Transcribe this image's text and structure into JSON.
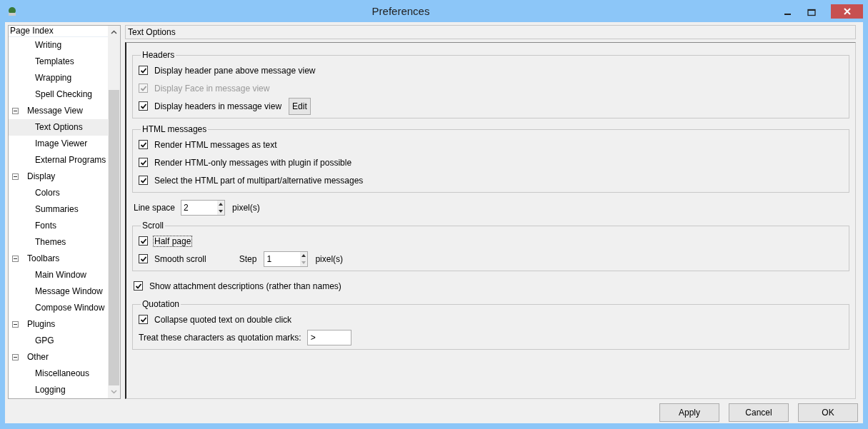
{
  "window": {
    "title": "Preferences"
  },
  "sidebar": {
    "header": "Page Index",
    "items": [
      {
        "children": [
          {
            "label": "Writing",
            "selected": false
          },
          {
            "label": "Templates",
            "selected": false
          },
          {
            "label": "Wrapping",
            "selected": false
          },
          {
            "label": "Spell Checking",
            "selected": false
          }
        ]
      },
      {
        "label": "Message View",
        "expanded": true,
        "children": [
          {
            "label": "Text Options",
            "selected": true
          },
          {
            "label": "Image Viewer",
            "selected": false
          },
          {
            "label": "External Programs",
            "selected": false
          }
        ]
      },
      {
        "label": "Display",
        "expanded": true,
        "children": [
          {
            "label": "Colors",
            "selected": false
          },
          {
            "label": "Summaries",
            "selected": false
          },
          {
            "label": "Fonts",
            "selected": false
          },
          {
            "label": "Themes",
            "selected": false
          }
        ]
      },
      {
        "label": "Toolbars",
        "expanded": true,
        "children": [
          {
            "label": "Main Window",
            "selected": false
          },
          {
            "label": "Message Window",
            "selected": false
          },
          {
            "label": "Compose Window",
            "selected": false
          }
        ]
      },
      {
        "label": "Plugins",
        "expanded": true,
        "children": [
          {
            "label": "GPG",
            "selected": false
          }
        ]
      },
      {
        "label": "Other",
        "expanded": true,
        "children": [
          {
            "label": "Miscellaneous",
            "selected": false
          },
          {
            "label": "Logging",
            "selected": false
          }
        ]
      }
    ]
  },
  "page": {
    "title": "Text Options",
    "items": [
      {
        "kind": "group",
        "title": "Headers",
        "rows": [
          {
            "kind": "checkbox",
            "label": "Display header pane above message view",
            "checked": true,
            "disabled": false,
            "focused": false
          },
          {
            "kind": "checkbox",
            "label": "Display Face in message view",
            "checked": true,
            "disabled": true,
            "focused": false
          },
          {
            "kind": "checkbox_button",
            "label": "Display headers in message view",
            "checked": true,
            "disabled": false,
            "focused": false,
            "button": "Edit"
          }
        ]
      },
      {
        "kind": "group",
        "title": "HTML messages",
        "rows": [
          {
            "kind": "checkbox",
            "label": "Render HTML messages as text",
            "checked": true,
            "disabled": false,
            "focused": false
          },
          {
            "kind": "checkbox",
            "label": "Render HTML-only messages with plugin if possible",
            "checked": true,
            "disabled": false,
            "focused": false
          },
          {
            "kind": "checkbox",
            "label": "Select the HTML part of multipart/alternative messages",
            "checked": true,
            "disabled": false,
            "focused": false
          }
        ]
      },
      {
        "kind": "spin",
        "label": "Line space",
        "value": "2",
        "unit": "pixel(s)"
      },
      {
        "kind": "group",
        "title": "Scroll",
        "rows": [
          {
            "kind": "checkbox",
            "label": "Half page",
            "checked": true,
            "disabled": false,
            "focused": true
          },
          {
            "kind": "checkbox_spin",
            "label": "Smooth scroll",
            "checked": true,
            "disabled": false,
            "focused": false,
            "spin_label": "Step",
            "value": "1",
            "unit": "pixel(s)"
          }
        ]
      },
      {
        "kind": "checkbox",
        "label": "Show attachment descriptions (rather than names)",
        "checked": true
      },
      {
        "kind": "group",
        "title": "Quotation",
        "rows": [
          {
            "kind": "checkbox",
            "label": "Collapse quoted text on double click",
            "checked": true,
            "disabled": false,
            "focused": false
          },
          {
            "kind": "text_field",
            "label": "Treat these characters as quotation marks:",
            "value": ">"
          }
        ]
      }
    ]
  },
  "buttons": [
    "Apply",
    "Cancel",
    "OK"
  ]
}
